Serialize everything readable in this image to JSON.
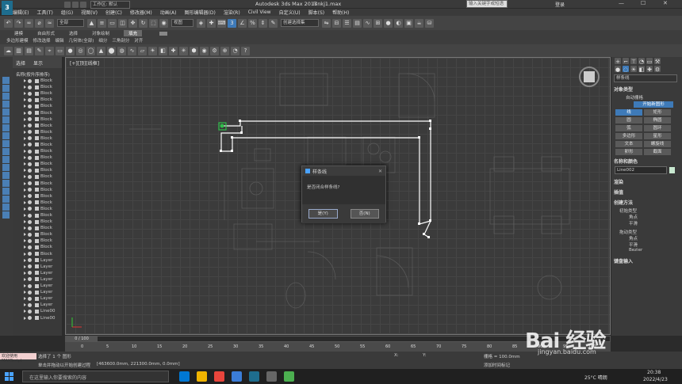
{
  "app": {
    "title": "Autodesk 3ds Max 2017",
    "file": "lsnkj1.max",
    "workspace": "工作区: 默认",
    "search_placeholder": "输入关键字或短语",
    "user": "登录",
    "logo": "3"
  },
  "menu": [
    "编辑(E)",
    "工具(T)",
    "组(G)",
    "视图(V)",
    "创建(C)",
    "修改器(M)",
    "动画(A)",
    "图形编辑器(D)",
    "渲染(R)",
    "Civil View",
    "自定义(U)",
    "脚本(S)",
    "帮助(H)"
  ],
  "toolbar": {
    "filter": "全部",
    "view": "视图",
    "selection_set": "创建选择集"
  },
  "ribbon": {
    "tabs": [
      "建模",
      "自由形式",
      "选择",
      "对象绘制",
      "填充"
    ],
    "active": "填充",
    "subtabs": [
      "多边形建模",
      "修改选择",
      "编辑",
      "几何体(全部)",
      "细分",
      "三角剖分",
      "对齐",
      "可见性",
      "属性"
    ]
  },
  "ribbon_row2": [
    "建模",
    "自由形式",
    "选择",
    "对象绘制"
  ],
  "explorer": {
    "tabs": [
      "选择",
      "显示"
    ],
    "header": "名称(按升序排序)",
    "items": [
      "Block",
      "Block",
      "Block",
      "Block",
      "Block",
      "Block",
      "Block",
      "Block",
      "Block",
      "Block",
      "Block",
      "Block",
      "Block",
      "Block",
      "Block",
      "Block",
      "Block",
      "Block",
      "Block",
      "Block",
      "Block",
      "Block",
      "Block",
      "Block",
      "Block",
      "Block",
      "Block",
      "Block",
      "Layer",
      "Layer",
      "Layer",
      "Layer",
      "Layer",
      "Layer",
      "Layer",
      "Layer",
      "Line00",
      "Line00"
    ]
  },
  "viewport": {
    "label": "[+][顶][线框]"
  },
  "dialog": {
    "title": "样条线",
    "message": "是否闭合样条线?",
    "yes": "是(Y)",
    "no": "否(N)"
  },
  "rightpanel": {
    "category": "样条线",
    "object_type_header": "对象类型",
    "autogrid": "自动栅格",
    "start_new": "开始新图形",
    "buttons": [
      "线",
      "矩形",
      "圆",
      "椭圆",
      "弧",
      "圆环",
      "多边形",
      "星形",
      "文本",
      "螺旋线",
      "卵形",
      "截面"
    ],
    "active_button": "线",
    "name_color_header": "名称和颜色",
    "object_name": "Line002",
    "render_header": "渲染",
    "interp_header": "插值",
    "creation_header": "创建方法",
    "initial_type": "初始类型",
    "initial_options": [
      "角点",
      "平滑"
    ],
    "drag_type": "拖动类型",
    "drag_options": [
      "角点",
      "平滑",
      "Bezier"
    ],
    "keyboard_header": "键盘输入"
  },
  "timeline": {
    "frame": "0 / 100",
    "ticks": [
      "0",
      "5",
      "10",
      "15",
      "20",
      "25",
      "30",
      "35",
      "40",
      "45",
      "50",
      "55",
      "60",
      "65",
      "70",
      "75",
      "80",
      "85",
      "90",
      "95",
      "100"
    ]
  },
  "status": {
    "selected": "选择了 1 个 图形",
    "prompt": "单击并拖动以开始创建过程",
    "coords": "[463600.0mm, 221300.0mm, 0.0mm]",
    "x": "X:",
    "y": "Y:",
    "grid": "栅格 = 100.0mm",
    "add_key": "添加时间标记",
    "welcome": "欢迎使用 MAXScript"
  },
  "taskbar": {
    "search": "在这里输入你要搜索的内容",
    "weather": "25°C 晴朗",
    "time": "20:38",
    "date": "2022/4/23"
  },
  "watermark": {
    "brand": "Bai 经验",
    "url": "jingyan.baidu.com"
  },
  "colors": {
    "accent": "#3e7ab8",
    "spline": "#ffffff",
    "selection": "#2fbf4a",
    "object_color": "#c8e8d0"
  }
}
